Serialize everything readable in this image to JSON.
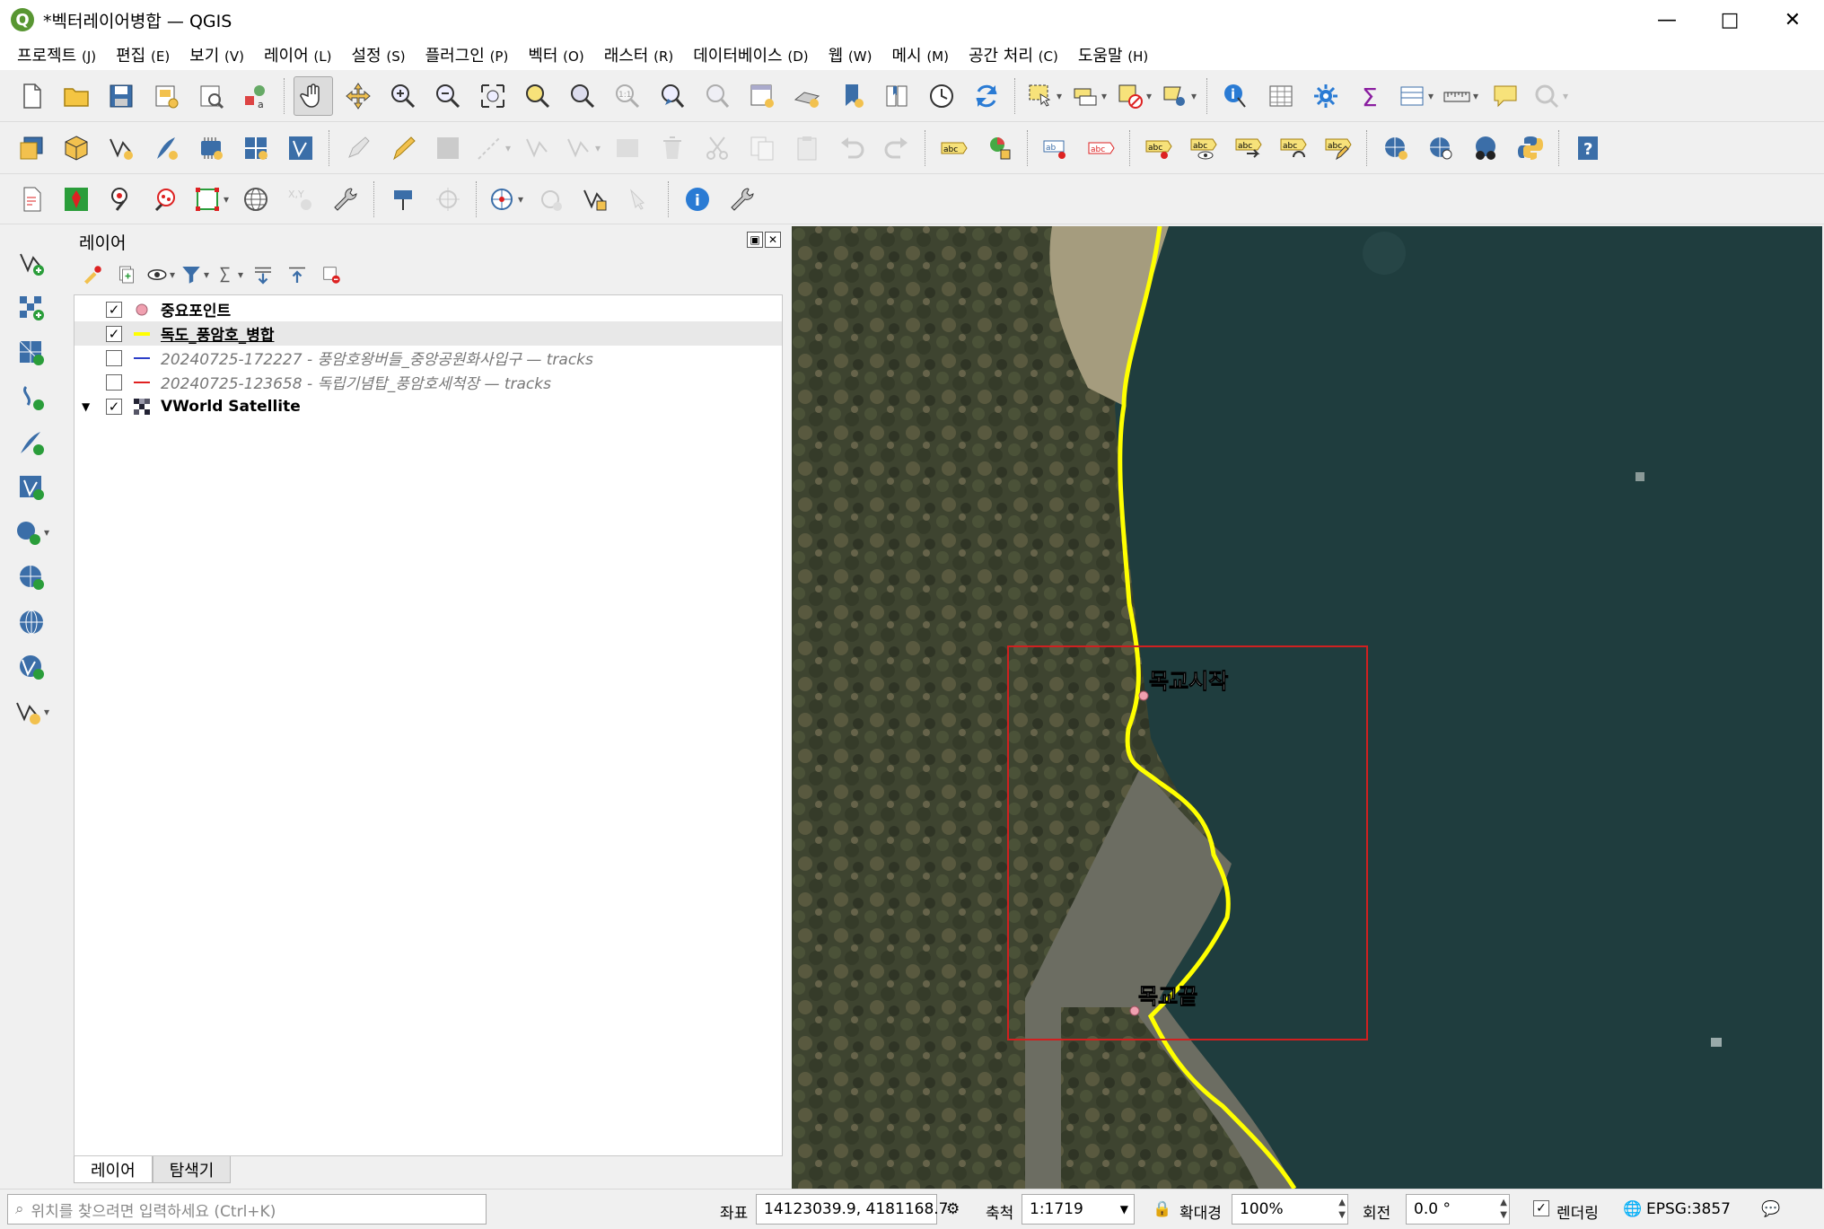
{
  "window": {
    "title": "*벡터레이어병합 — QGIS",
    "app_icon": "Q"
  },
  "menu": [
    {
      "label": "프로젝트",
      "key": "(J)"
    },
    {
      "label": "편집",
      "key": "(E)"
    },
    {
      "label": "보기",
      "key": "(V)"
    },
    {
      "label": "레이어",
      "key": "(L)"
    },
    {
      "label": "설정",
      "key": "(S)"
    },
    {
      "label": "플러그인",
      "key": "(P)"
    },
    {
      "label": "벡터",
      "key": "(O)"
    },
    {
      "label": "래스터",
      "key": "(R)"
    },
    {
      "label": "데이터베이스",
      "key": "(D)"
    },
    {
      "label": "웹",
      "key": "(W)"
    },
    {
      "label": "메시",
      "key": "(M)"
    },
    {
      "label": "공간 처리",
      "key": "(C)"
    },
    {
      "label": "도움말",
      "key": "(H)"
    }
  ],
  "toolbar_labels": {
    "abc": "abc",
    "ab": "ab",
    "xy": "X,Y",
    "one_one": "1:1",
    "sigma": "Σ",
    "info_i": "i",
    "help_q": "?"
  },
  "layers_panel": {
    "title": "레이어",
    "layers": [
      {
        "name": "중요포인트",
        "checked": true,
        "symbol": "point",
        "color": "#f0a0b0",
        "style": "bold"
      },
      {
        "name": "독도_풍암호_병합",
        "checked": true,
        "symbol": "line",
        "color": "#ffff00",
        "style": "bold-underline",
        "selected": true
      },
      {
        "name": "20240725-172227 - 풍암호왕버들_중앙공원화사입구 — tracks",
        "checked": false,
        "symbol": "line",
        "color": "#2c3ec8",
        "style": "italic"
      },
      {
        "name": "20240725-123658 - 독립기념탑_풍암호세척장 — tracks",
        "checked": false,
        "symbol": "line",
        "color": "#e02020",
        "style": "italic"
      },
      {
        "name": "VWorld Satellite",
        "checked": true,
        "symbol": "raster",
        "color": "#333333",
        "style": "bold",
        "expanded": true
      }
    ],
    "tabs": [
      "레이어",
      "탐색기"
    ],
    "check_mark": "✓",
    "expand_glyph": "▼"
  },
  "map": {
    "labels": [
      "목교시작",
      "목교끝"
    ],
    "track_color": "#ffff00",
    "box_color": "#d02020",
    "water_color": "#1f3d3e"
  },
  "statusbar": {
    "locator_placeholder": "위치를 찾으려면 입력하세요 (Ctrl+K)",
    "coord_label": "좌표",
    "coord_value": "14123039.9, 4181168.7",
    "scale_label": "축척",
    "scale_value": "1:1719",
    "magnifier_label": "확대경",
    "magnifier_value": "100%",
    "rotation_label": "회전",
    "rotation_value": "0.0 °",
    "render_label": "렌더링",
    "render_checked": "✓",
    "crs": "EPSG:3857"
  }
}
